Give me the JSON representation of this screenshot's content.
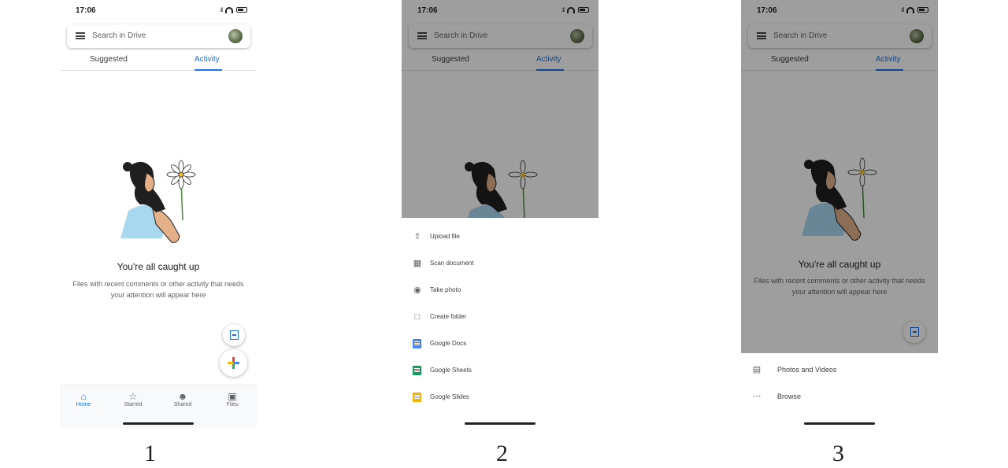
{
  "screens": [
    {
      "status": {
        "time": "17:06"
      },
      "search": {
        "placeholder": "Search in Drive"
      },
      "tabs": [
        "Suggested",
        "Activity"
      ],
      "empty": {
        "title": "You're all caught up",
        "body": "Files with recent comments or other activity that needs your attention will appear here"
      },
      "nav": [
        {
          "label": "Home",
          "icon": "home-icon"
        },
        {
          "label": "Starred",
          "icon": "star-icon"
        },
        {
          "label": "Shared",
          "icon": "people-icon"
        },
        {
          "label": "Files",
          "icon": "folder-icon"
        }
      ],
      "caption": "1"
    },
    {
      "status": {
        "time": "17:06"
      },
      "search": {
        "placeholder": "Search in Drive"
      },
      "tabs": [
        "Suggested",
        "Activity"
      ],
      "sheet": [
        {
          "label": "Upload file",
          "icon": "upload-icon"
        },
        {
          "label": "Scan document",
          "icon": "scan-icon"
        },
        {
          "label": "Take photo",
          "icon": "camera-icon"
        },
        {
          "label": "Create folder",
          "icon": "folder-icon"
        },
        {
          "label": "Google Docs",
          "icon": "docs-icon"
        },
        {
          "label": "Google Sheets",
          "icon": "sheets-icon"
        },
        {
          "label": "Google Slides",
          "icon": "slides-icon"
        }
      ],
      "caption": "2"
    },
    {
      "status": {
        "time": "17:06"
      },
      "search": {
        "placeholder": "Search in Drive"
      },
      "tabs": [
        "Suggested",
        "Activity"
      ],
      "empty": {
        "title": "You're all caught up",
        "body": "Files with recent comments or other activity that needs your attention will appear here"
      },
      "sheet": [
        {
          "label": "Photos and Videos",
          "icon": "photos-icon"
        },
        {
          "label": "Browse",
          "icon": "more-icon"
        }
      ],
      "caption": "3"
    }
  ],
  "colors": {
    "accent": "#1a73e8",
    "docs": "#4285f4",
    "sheets": "#0f9d58",
    "slides": "#f4b400"
  }
}
